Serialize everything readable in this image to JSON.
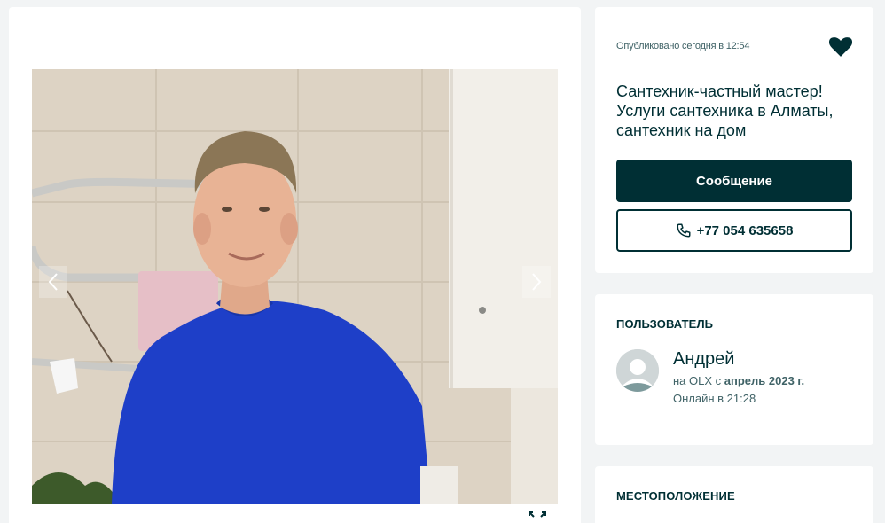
{
  "ad": {
    "published": "Опубликовано сегодня в 12:54",
    "title": "Сантехник-частный мастер! Услуги сантехника в Алматы, сантехник на дом",
    "message_label": "Сообщение",
    "phone_label": "+77 054 635658"
  },
  "user": {
    "heading": "ПОЛЬЗОВАТЕЛЬ",
    "name": "Андрей",
    "since_prefix": "на OLX с ",
    "since_date": "апрель 2023 г.",
    "online": "Онлайн в 21:28"
  },
  "location": {
    "heading": "МЕСТОПОЛОЖЕНИЕ"
  },
  "icons": {
    "favorite": "heart-icon",
    "phone": "phone-icon",
    "prev": "chevron-left-icon",
    "next": "chevron-right-icon",
    "expand": "expand-icon"
  },
  "colors": {
    "brand_dark": "#002f34",
    "muted_text": "#406367",
    "page_bg": "#f2f4f5"
  }
}
